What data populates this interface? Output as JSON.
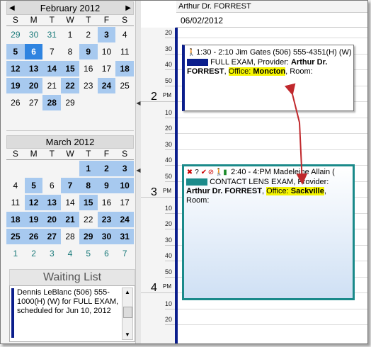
{
  "calendar_feb": {
    "title": "February 2012",
    "days_of_week": [
      "S",
      "M",
      "T",
      "W",
      "T",
      "F",
      "S"
    ],
    "weeks": [
      [
        "29",
        "30",
        "31",
        "1",
        "2",
        "3",
        "4"
      ],
      [
        "5",
        "6",
        "7",
        "8",
        "9",
        "10",
        "11"
      ],
      [
        "12",
        "13",
        "14",
        "15",
        "16",
        "17",
        "18"
      ],
      [
        "19",
        "20",
        "21",
        "22",
        "23",
        "24",
        "25"
      ],
      [
        "26",
        "27",
        "28",
        "29",
        "",
        "",
        ""
      ]
    ]
  },
  "calendar_mar": {
    "title": "March 2012",
    "days_of_week": [
      "S",
      "M",
      "T",
      "W",
      "T",
      "F",
      "S"
    ],
    "weeks": [
      [
        "",
        "",
        "",
        "",
        "1",
        "2",
        "3"
      ],
      [
        "4",
        "5",
        "6",
        "7",
        "8",
        "9",
        "10"
      ],
      [
        "11",
        "12",
        "13",
        "14",
        "15",
        "16",
        "17"
      ],
      [
        "18",
        "19",
        "20",
        "21",
        "22",
        "23",
        "24"
      ],
      [
        "25",
        "26",
        "27",
        "28",
        "29",
        "30",
        "31"
      ],
      [
        "1",
        "2",
        "3",
        "4",
        "5",
        "6",
        "7"
      ]
    ]
  },
  "waiting_list": {
    "title": "Waiting List",
    "item": "Dennis LeBlanc  (506) 555-1000(H)  (W) for FULL EXAM, scheduled for Jun 10, 2012"
  },
  "schedule": {
    "provider": "Arthur Dr. FORREST",
    "date": "06/02/2012",
    "time_labels": [
      "20",
      "30",
      "40",
      "50",
      "2",
      "10",
      "20",
      "30",
      "40",
      "50",
      "3",
      "10",
      "20",
      "30",
      "40",
      "50",
      "4",
      "10",
      "20"
    ],
    "pm": "PM"
  },
  "appt1": {
    "line1": "1:30 - 2:10 Jim Gates  (506) 555-4351(H)  (W)",
    "type": "FULL EXAM, Provider: ",
    "provider_bold": "Arthur Dr.",
    "provider_bold2": "FORREST",
    "office_label": "Office: ",
    "office": "Moncton",
    "room": ", Room:"
  },
  "appt2": {
    "line1": "2:40 - 4:PM Madeleine Allain (",
    "type": "CONTACT LENS EXAM, Provider:",
    "provider_bold": "Arthur Dr. FORREST",
    "office_label": "Office: ",
    "office": "Sackville",
    "room": "Room:"
  },
  "colors": {
    "appt1_bar": "#0b1e8c",
    "appt2_swatch": "#1a8a8a",
    "arrow": "#c0282c"
  }
}
